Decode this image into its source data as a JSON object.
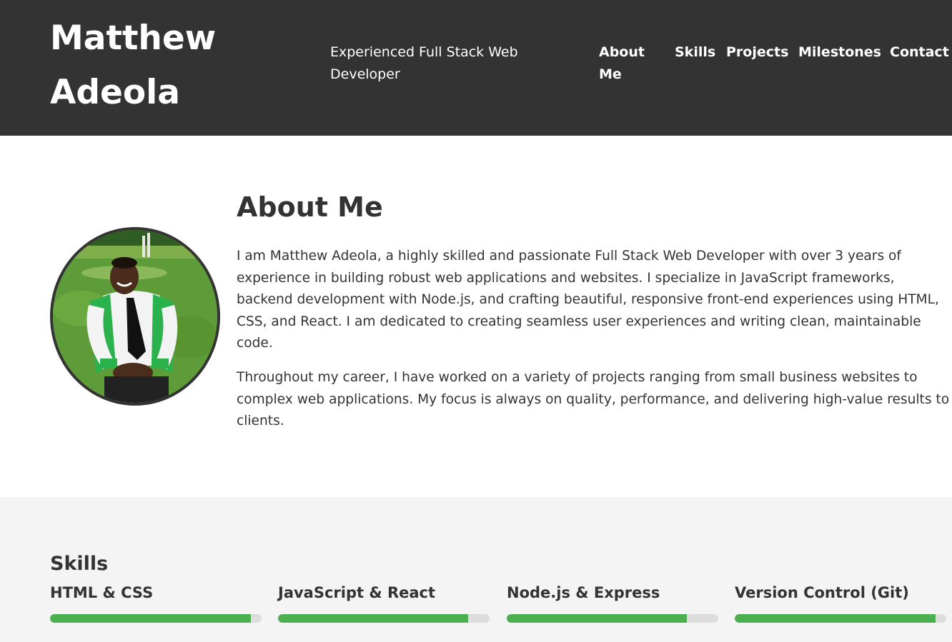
{
  "header": {
    "name": "Matthew Adeola",
    "tagline": "Experienced Full Stack Web Developer",
    "nav": [
      {
        "label": "About Me"
      },
      {
        "label": "Skills"
      },
      {
        "label": "Projects"
      },
      {
        "label": "Milestones"
      },
      {
        "label": "Contact"
      }
    ]
  },
  "about": {
    "title": "About Me",
    "paragraphs": [
      "I am Matthew Adeola, a highly skilled and passionate Full Stack Web Developer with over 3 years of experience in building robust web applications and websites. I specialize in JavaScript frameworks, backend development with Node.js, and crafting beautiful, responsive front-end experiences using HTML, CSS, and React. I am dedicated to creating seamless user experiences and writing clean, maintainable code.",
      "Throughout my career, I have worked on a variety of projects ranging from small business websites to complex web applications. My focus is always on quality, performance, and delivering high-value results to clients."
    ]
  },
  "skills": {
    "title": "Skills",
    "items": [
      {
        "name": "HTML & CSS",
        "level": 0.95
      },
      {
        "name": "JavaScript & React",
        "level": 0.9
      },
      {
        "name": "Node.js & Express",
        "level": 0.85
      },
      {
        "name": "Version Control (Git)",
        "level": 0.95
      }
    ]
  },
  "colors": {
    "header_bg": "#333333",
    "skills_bg": "#f4f4f4",
    "progress_fill": "#4caf50",
    "progress_track": "#dddddd"
  }
}
